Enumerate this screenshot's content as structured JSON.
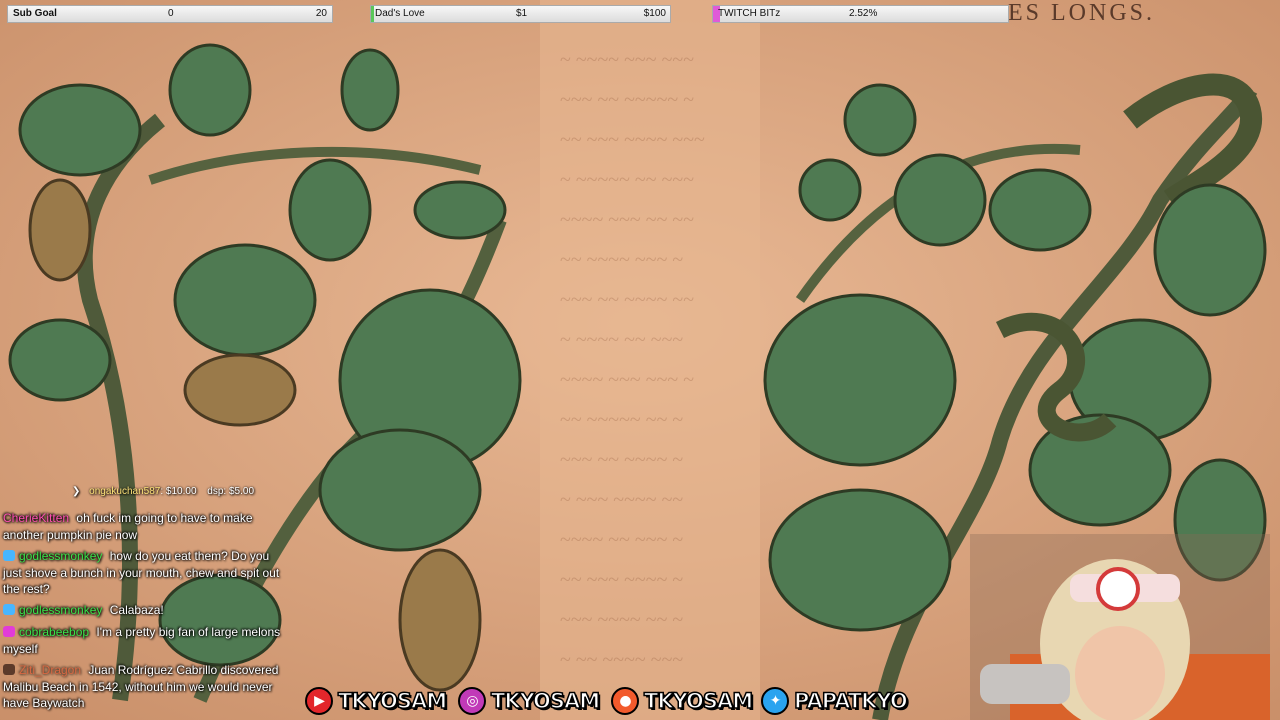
{
  "overlay": {
    "sub_goal": {
      "label": "Sub Goal",
      "current": "0",
      "target": "20",
      "progress": 0.0
    },
    "dads_love": {
      "label": "Dad's Love",
      "current": "$1",
      "target": "$100",
      "progress": 0.01
    },
    "twitch_bitz": {
      "label": "TWITCH BITz",
      "percent": "2.52%",
      "progress": 0.0252
    }
  },
  "page_header": "ES LONGS.",
  "donation_ticker": {
    "text_name": "ongakuchan587",
    "text_amount": ": $10.00",
    "text_next": "dsp: $5.00"
  },
  "chat": [
    {
      "user": "CherieKitten",
      "user_color": "#ff4fb3",
      "badge_color": "",
      "text": "oh fuck im going to have to make another pumpkin pie now"
    },
    {
      "user": "godlessmonkey",
      "user_color": "#39e34a",
      "badge_color": "#48b6ff",
      "text": "how do you eat them? Do you just shove a bunch in your mouth, chew and spit out the rest?"
    },
    {
      "user": "godlessmonkey",
      "user_color": "#39e34a",
      "badge_color": "#48b6ff",
      "text": "Calabaza!"
    },
    {
      "user": "cobrabeebop",
      "user_color": "#39e34a",
      "badge_color": "#e23bd8",
      "text": "I'm a pretty big fan of large melons myself"
    },
    {
      "user": "Ziti_Dragon",
      "user_color": "#e0451f",
      "badge_color": "#5c3a2a",
      "text": "Juan Rodríguez Cabrillo discovered Malibu Beach in 1542, without him we would never have Baywatch"
    }
  ],
  "socials": [
    {
      "platform": "youtube-icon",
      "handle": "TKYOSAM",
      "color": "#e3262b"
    },
    {
      "platform": "instagram-icon",
      "handle": "TKYOSAM",
      "color": "#c13ab8"
    },
    {
      "platform": "patreon-icon",
      "handle": "TKYOSAM",
      "color": "#f25a2c"
    },
    {
      "platform": "twitter-icon",
      "handle": "PAPATKYO",
      "color": "#2aa3ef"
    }
  ]
}
